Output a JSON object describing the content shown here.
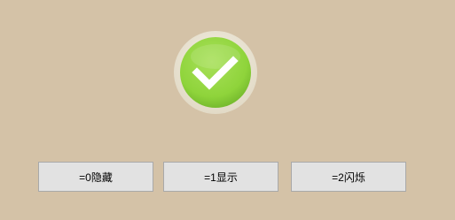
{
  "indicator": {
    "icon": "checkmark-icon",
    "state": "on",
    "color": "#8fd43b",
    "ring_color": "#ece6d6"
  },
  "buttons": [
    {
      "label": "=0隐藏"
    },
    {
      "label": "=1显示"
    },
    {
      "label": "=2闪烁"
    }
  ]
}
